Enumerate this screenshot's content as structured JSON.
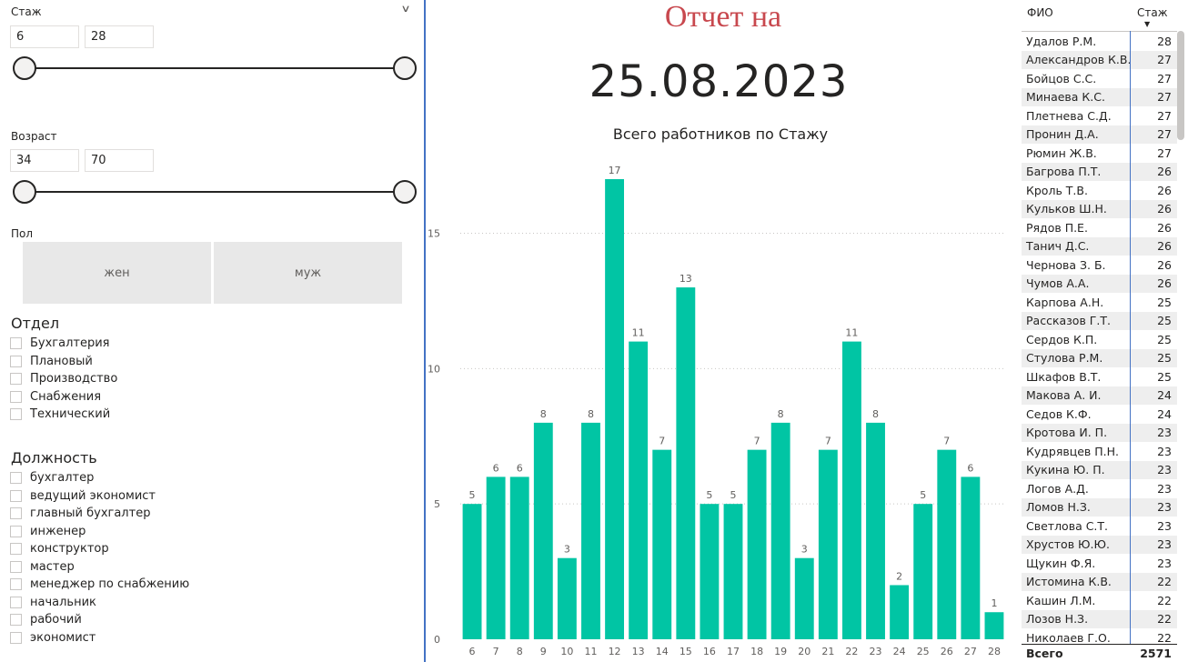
{
  "filters": {
    "stazh": {
      "label": "Стаж",
      "min": "6",
      "max": "28"
    },
    "vozrast": {
      "label": "Возраст",
      "min": "34",
      "max": "70"
    },
    "pol": {
      "label": "Пол",
      "options": [
        "жен",
        "муж"
      ]
    },
    "otdel": {
      "label": "Отдел",
      "options": [
        "Бухгалтерия",
        "Плановый",
        "Производство",
        "Снабжения",
        "Технический"
      ]
    },
    "dolzhnost": {
      "label": "Должность",
      "options": [
        "бухгалтер",
        "ведущий экономист",
        "главный бухгалтер",
        "инженер",
        "конструктор",
        "мастер",
        "менеджер по снабжению",
        "начальник",
        "рабочий",
        "экономист"
      ]
    }
  },
  "report": {
    "title": "Отчет на",
    "date": "25.08.2023"
  },
  "chart_data": {
    "type": "bar",
    "title": "Всего работников по Стажу",
    "xlabel": "",
    "ylabel": "",
    "categories": [
      "6",
      "7",
      "8",
      "9",
      "10",
      "11",
      "12",
      "13",
      "14",
      "15",
      "16",
      "17",
      "18",
      "19",
      "20",
      "21",
      "22",
      "23",
      "24",
      "25",
      "26",
      "27",
      "28"
    ],
    "values": [
      5,
      6,
      6,
      8,
      3,
      8,
      17,
      11,
      7,
      13,
      5,
      5,
      7,
      8,
      3,
      7,
      11,
      8,
      2,
      5,
      7,
      6,
      1
    ],
    "yticks": [
      0,
      5,
      10,
      15
    ],
    "ylim": [
      0,
      17
    ],
    "grid": true,
    "bar_color": "#01c5a4"
  },
  "table": {
    "headers": {
      "name": "ФИО",
      "value": "Стаж"
    },
    "rows": [
      [
        "Удалов Р.М.",
        "28"
      ],
      [
        "Александров К.В.",
        "27"
      ],
      [
        "Бойцов С.С.",
        "27"
      ],
      [
        "Минаева К.С.",
        "27"
      ],
      [
        "Плетнева С.Д.",
        "27"
      ],
      [
        "Пронин Д.А.",
        "27"
      ],
      [
        "Рюмин Ж.В.",
        "27"
      ],
      [
        "Багрова П.Т.",
        "26"
      ],
      [
        "Кроль Т.В.",
        "26"
      ],
      [
        "Кульков Ш.Н.",
        "26"
      ],
      [
        "Рядов П.Е.",
        "26"
      ],
      [
        "Танич Д.С.",
        "26"
      ],
      [
        "Чернова З. Б.",
        "26"
      ],
      [
        "Чумов А.А.",
        "26"
      ],
      [
        "Карпова А.Н.",
        "25"
      ],
      [
        "Рассказов Г.Т.",
        "25"
      ],
      [
        "Сердов К.П.",
        "25"
      ],
      [
        "Стулова Р.М.",
        "25"
      ],
      [
        "Шкафов В.Т.",
        "25"
      ],
      [
        "Макова А. И.",
        "24"
      ],
      [
        "Седов К.Ф.",
        "24"
      ],
      [
        "Кротова И. П.",
        "23"
      ],
      [
        "Кудрявцев П.Н.",
        "23"
      ],
      [
        "Кукина Ю. П.",
        "23"
      ],
      [
        "Логов А.Д.",
        "23"
      ],
      [
        "Ломов Н.З.",
        "23"
      ],
      [
        "Светлова С.Т.",
        "23"
      ],
      [
        "Хрустов Ю.Ю.",
        "23"
      ],
      [
        "Щукин Ф.Я.",
        "23"
      ],
      [
        "Истомина К.В.",
        "22"
      ],
      [
        "Кашин Л.М.",
        "22"
      ],
      [
        "Лозов Н.З.",
        "22"
      ],
      [
        "Николаев Г.О.",
        "22"
      ]
    ],
    "total": {
      "label": "Всего",
      "value": "2571"
    }
  }
}
